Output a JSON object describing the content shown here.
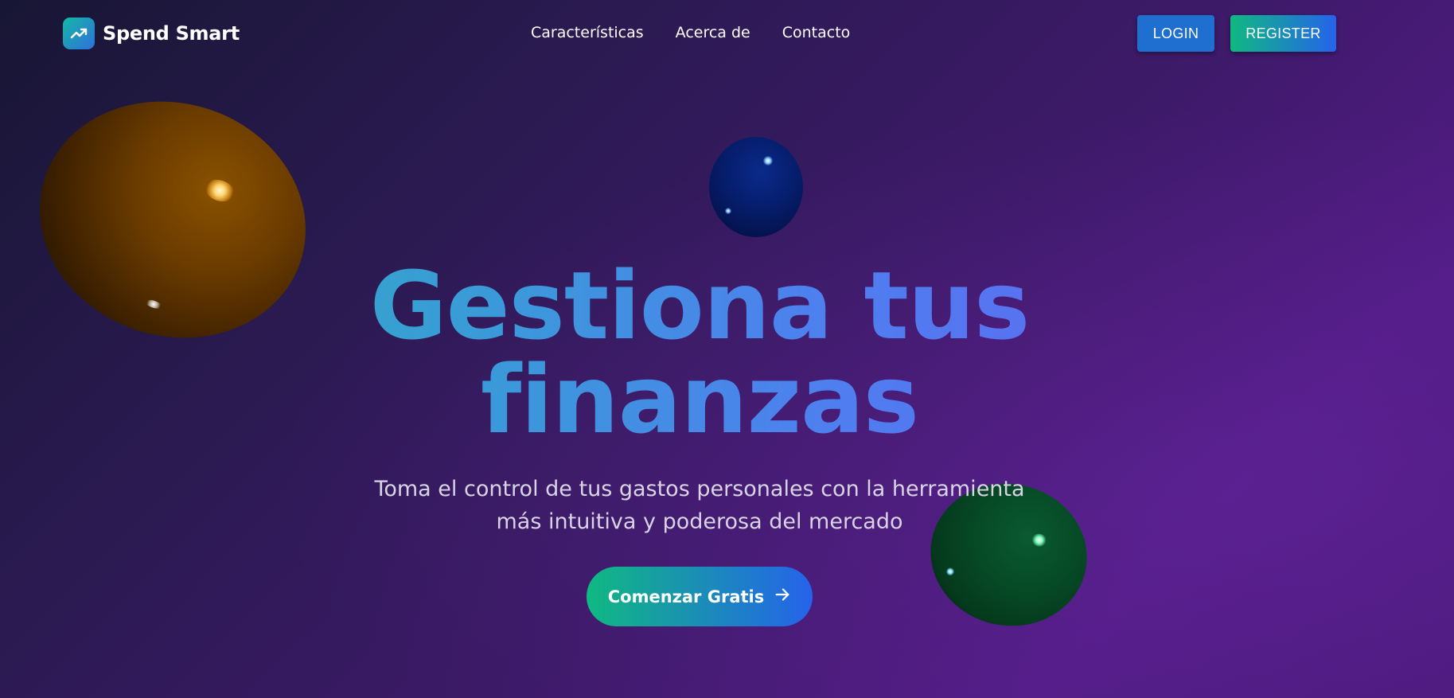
{
  "brand": {
    "name": "Spend Smart",
    "logo_icon": "trending-up-icon"
  },
  "nav": {
    "links": [
      {
        "label": "Características"
      },
      {
        "label": "Acerca de"
      },
      {
        "label": "Contacto"
      }
    ],
    "login_label": "LOGIN",
    "register_label": "REGISTER"
  },
  "hero": {
    "title_line1": "Gestiona tus",
    "title_line2": "finanzas",
    "subtitle_line1": "Toma el control de tus gastos personales con la herramienta",
    "subtitle_line2": "más intuitiva y poderosa del mercado",
    "cta_label": "Comenzar Gratis",
    "cta_icon": "arrow-right-icon"
  },
  "colors": {
    "accent_teal": "#10b981",
    "accent_blue": "#2563eb",
    "login_button": "#1e6fd0",
    "background_dark": "#181634",
    "background_purple": "#511c84"
  }
}
